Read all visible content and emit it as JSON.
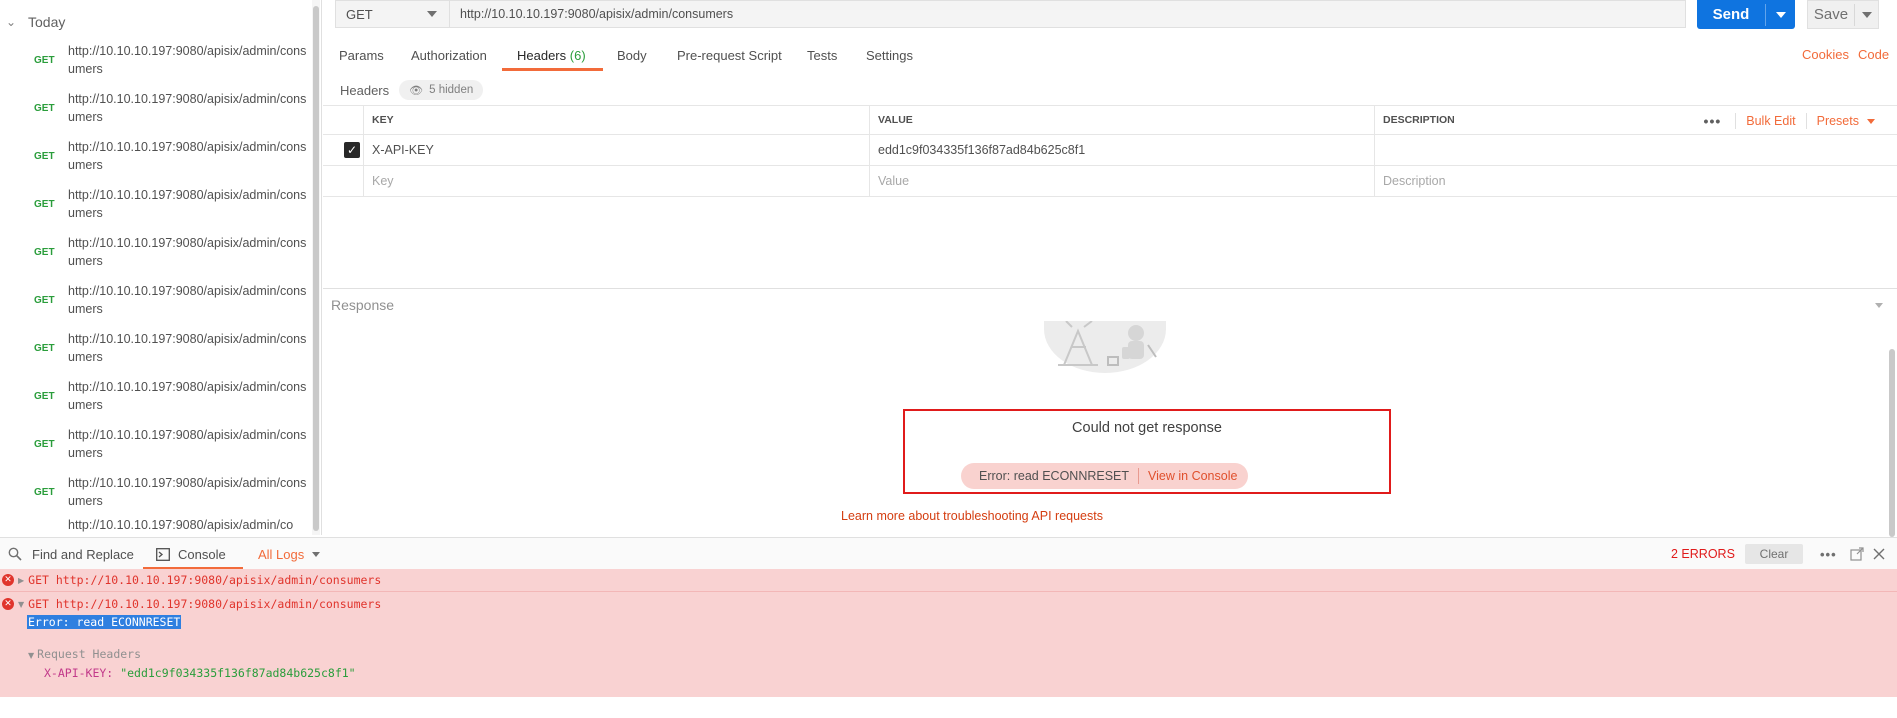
{
  "sidebar": {
    "group_label": "Today",
    "items": [
      {
        "method": "GET",
        "url": "http://10.10.10.197:9080/apisix/admin/consumers"
      },
      {
        "method": "GET",
        "url": "http://10.10.10.197:9080/apisix/admin/consumers"
      },
      {
        "method": "GET",
        "url": "http://10.10.10.197:9080/apisix/admin/consumers"
      },
      {
        "method": "GET",
        "url": "http://10.10.10.197:9080/apisix/admin/consumers"
      },
      {
        "method": "GET",
        "url": "http://10.10.10.197:9080/apisix/admin/consumers"
      },
      {
        "method": "GET",
        "url": "http://10.10.10.197:9080/apisix/admin/consumers"
      },
      {
        "method": "GET",
        "url": "http://10.10.10.197:9080/apisix/admin/consumers"
      },
      {
        "method": "GET",
        "url": "http://10.10.10.197:9080/apisix/admin/consumers"
      },
      {
        "method": "GET",
        "url": "http://10.10.10.197:9080/apisix/admin/consumers"
      },
      {
        "method": "GET",
        "url": "http://10.10.10.197:9080/apisix/admin/consumers"
      },
      {
        "method": "",
        "url": "http://10.10.10.197:9080/apisix/admin/co"
      }
    ]
  },
  "request": {
    "method": "GET",
    "url": "http://10.10.10.197:9080/apisix/admin/consumers",
    "send_label": "Send",
    "save_label": "Save"
  },
  "tabs": {
    "params": "Params",
    "authorization": "Authorization",
    "headers": "Headers",
    "headers_count": "(6)",
    "body": "Body",
    "prerequest": "Pre-request Script",
    "tests": "Tests",
    "settings": "Settings",
    "cookies": "Cookies",
    "code": "Code"
  },
  "headers_section": {
    "title": "Headers",
    "hidden_label": "5 hidden",
    "columns": {
      "key": "KEY",
      "value": "VALUE",
      "description": "DESCRIPTION"
    },
    "bulk_edit": "Bulk Edit",
    "presets": "Presets",
    "rows": [
      {
        "checked": true,
        "key": "X-API-KEY",
        "value": "edd1c9f034335f136f87ad84b625c8f1",
        "description": ""
      }
    ],
    "placeholders": {
      "key": "Key",
      "value": "Value",
      "description": "Description"
    }
  },
  "response": {
    "title": "Response",
    "error_title": "Could not get response",
    "error_message": "Error: read ECONNRESET",
    "view_console": "View in Console",
    "learn_more": "Learn more about troubleshooting API requests"
  },
  "console_bar": {
    "find_replace": "Find and Replace",
    "console": "Console",
    "all_logs": "All Logs",
    "errors_count": "2 ERRORS",
    "clear": "Clear"
  },
  "console_log": {
    "line1": "GET http://10.10.10.197:9080/apisix/admin/consumers",
    "line2": "GET http://10.10.10.197:9080/apisix/admin/consumers",
    "error": "Error: read ECONNRESET",
    "request_headers": "Request Headers",
    "header_key": "X-API-KEY:",
    "header_value": "\"edd1c9f034335f136f87ad84b625c8f1\""
  },
  "colors": {
    "accent": "#f26b3a",
    "send": "#0f74e0",
    "get_method": "#2a9d3b",
    "error_red": "#e01b1b",
    "console_bg": "#f9d2d2"
  }
}
